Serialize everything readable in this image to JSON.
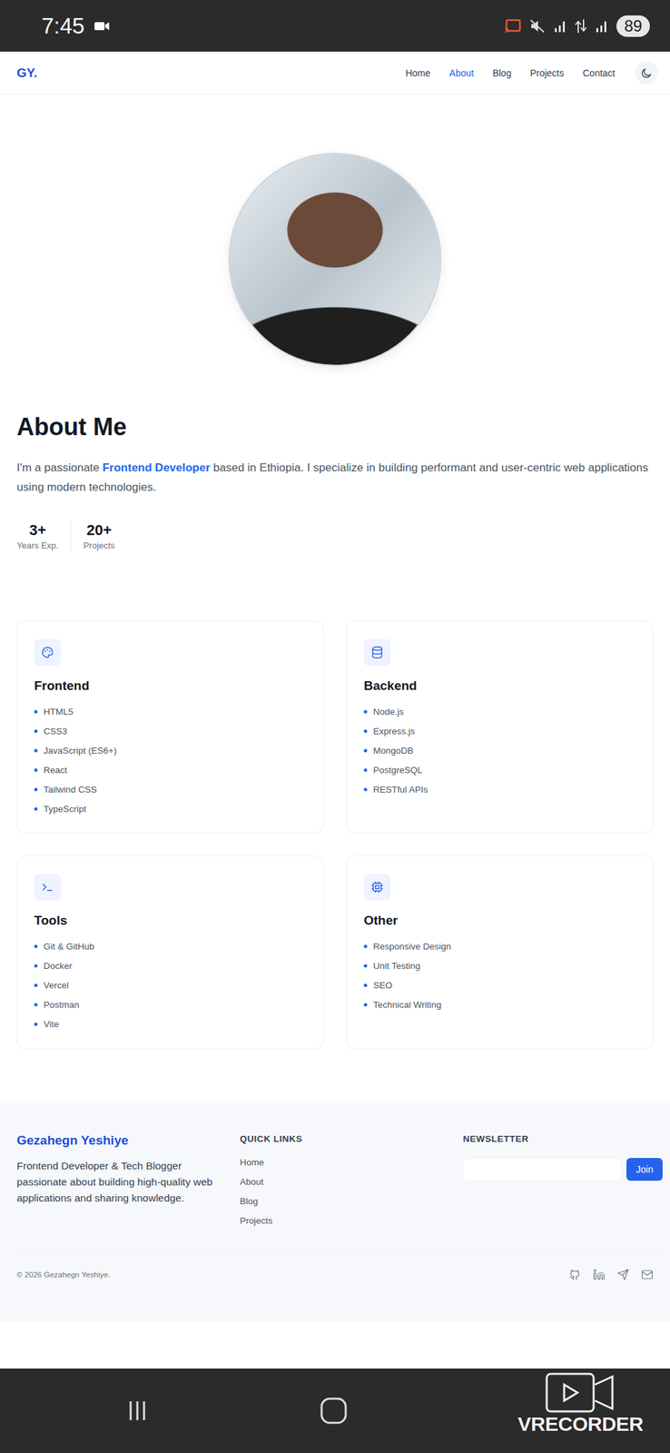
{
  "status_bar": {
    "time": "7:45",
    "battery": "89"
  },
  "nav": {
    "logo": "GY.",
    "links": [
      {
        "label": "Home",
        "selected": false
      },
      {
        "label": "About",
        "selected": true
      },
      {
        "label": "Blog",
        "selected": false
      },
      {
        "label": "Projects",
        "selected": false
      },
      {
        "label": "Contact",
        "selected": false
      }
    ]
  },
  "about": {
    "title": "About Me",
    "intro_before": "I'm a passionate ",
    "highlight": "Frontend Developer",
    "intro_after": " based in Ethiopia. I specialize in building performant and user-centric web applications using modern technologies."
  },
  "stats": [
    {
      "value": "3+",
      "label": "Years Exp."
    },
    {
      "value": "20+",
      "label": "Projects"
    }
  ],
  "skills": [
    {
      "title": "Frontend",
      "kind": "palette",
      "items": [
        "HTML5",
        "CSS3",
        "JavaScript (ES6+)",
        "React",
        "Tailwind CSS",
        "TypeScript"
      ]
    },
    {
      "title": "Backend",
      "kind": "database",
      "items": [
        "Node.js",
        "Express.js",
        "MongoDB",
        "PostgreSQL",
        "RESTful APIs"
      ]
    },
    {
      "title": "Tools",
      "kind": "terminal",
      "items": [
        "Git & GitHub",
        "Docker",
        "Vercel",
        "Postman",
        "Vite"
      ]
    },
    {
      "title": "Other",
      "kind": "chip",
      "items": [
        "Responsive Design",
        "Unit Testing",
        "SEO",
        "Technical Writing"
      ]
    }
  ],
  "footer": {
    "brand": "Gezahegn Yeshiye",
    "description": "Frontend Developer & Tech Blogger passionate about building high-quality web applications and sharing knowledge.",
    "quick_links_title": "QUICK LINKS",
    "quick_links": [
      "Home",
      "About",
      "Blog",
      "Projects"
    ],
    "newsletter_title": "NEWSLETTER",
    "join_button": "Join",
    "copyright": "© 2026 Gezahegn Yeshiye."
  },
  "watermark": "VRECORDER"
}
